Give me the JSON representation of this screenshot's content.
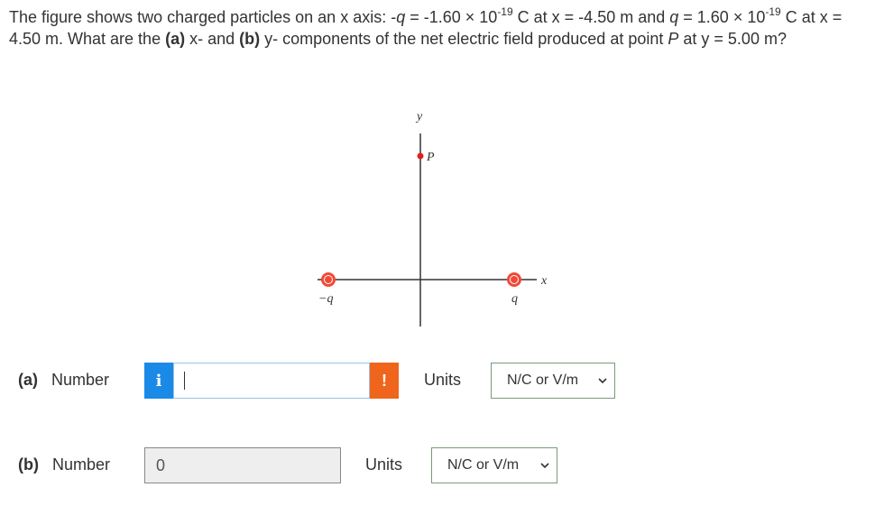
{
  "question": {
    "text_1": "The figure shows two charged particles on an x axis: -",
    "q_symbol": "q",
    "text_2": " = -1.60 × 10",
    "exp_1": "-19",
    "text_3": " C at x = -4.50 m and ",
    "text_4": " = 1.60 × 10",
    "exp_2": "-19",
    "text_5": " C at x = 4.50 m. What are the ",
    "part_a": "(a)",
    "text_6": " x- and ",
    "part_b": "(b)",
    "text_7": " y- components of the net electric field produced at point ",
    "point_symbol": "P",
    "text_8": " at y = 5.00 m?"
  },
  "figure": {
    "y_axis_label": "y",
    "x_axis_label": "x",
    "point_label": "P",
    "neg_charge_label": "−q",
    "pos_charge_label": "q",
    "colors": {
      "charge": "#f04a38",
      "point": "#e02020",
      "axis": "#333333"
    }
  },
  "part_a": {
    "label": "(a)",
    "number_label": "Number",
    "info_icon": "i",
    "value": "",
    "warning_icon": "!",
    "units_label": "Units",
    "unit_selected": "N/C or V/m"
  },
  "part_b": {
    "label": "(b)",
    "number_label": "Number",
    "value": "0",
    "units_label": "Units",
    "unit_selected": "N/C or V/m"
  }
}
